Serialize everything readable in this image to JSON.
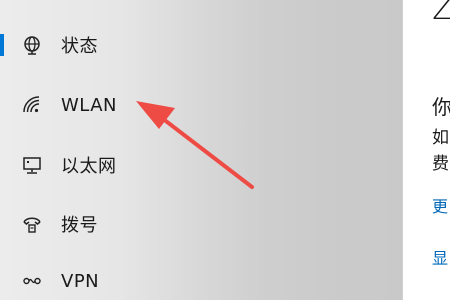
{
  "sidebar": {
    "items": [
      {
        "label": "状态",
        "icon": "globe-icon",
        "selected": true
      },
      {
        "label": "WLAN",
        "icon": "wifi-icon",
        "selected": false
      },
      {
        "label": "以太网",
        "icon": "ethernet-icon",
        "selected": false
      },
      {
        "label": "拨号",
        "icon": "dial-up-icon",
        "selected": false
      },
      {
        "label": "VPN",
        "icon": "vpn-icon",
        "selected": false
      }
    ]
  },
  "main": {
    "heading": "Z",
    "line1": "你",
    "line2": "如",
    "line3": "费",
    "link1": "更",
    "link2": "显"
  },
  "colors": {
    "accent": "#0078d7",
    "link": "#0067b8",
    "annotation_arrow": "#ee4b45"
  }
}
